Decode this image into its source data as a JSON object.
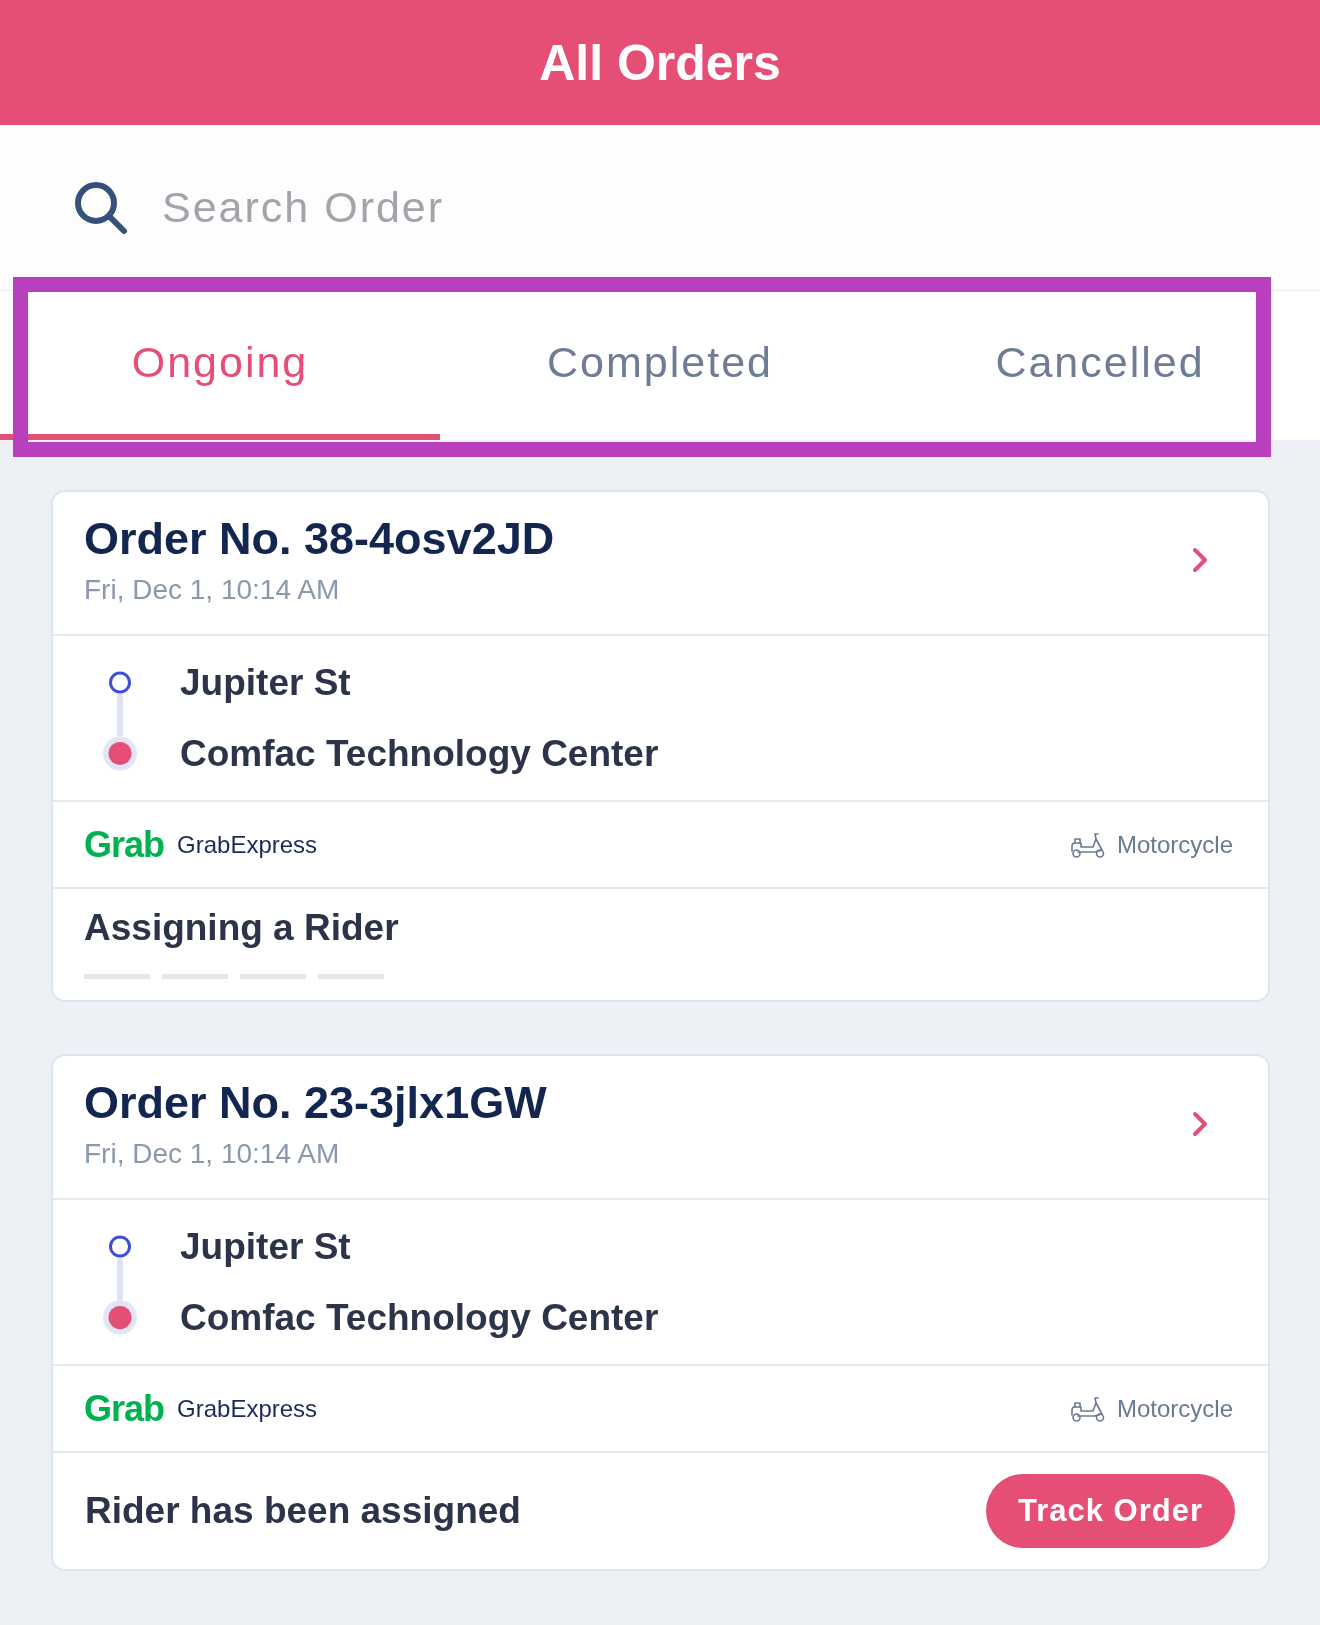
{
  "header": {
    "title": "All Orders"
  },
  "search": {
    "placeholder": "Search Order"
  },
  "tabs": {
    "highlighted": true,
    "items": [
      {
        "label": "Ongoing",
        "selected": true
      },
      {
        "label": "Completed",
        "selected": false
      },
      {
        "label": "Cancelled",
        "selected": false
      }
    ]
  },
  "orders": [
    {
      "number": "Order No. 38-4osv2JD",
      "date": "Fri, Dec 1, 10:14 AM",
      "stops": [
        {
          "kind": "pickup",
          "name": "Jupiter St"
        },
        {
          "kind": "dropoff",
          "name": "Comfac Technology Center"
        }
      ],
      "provider": {
        "logo": "Grab",
        "service": "GrabExpress"
      },
      "vehicle": "Motorcycle",
      "status": {
        "kind": "searching",
        "text": "Assigning a Rider"
      }
    },
    {
      "number": "Order No. 23-3jlx1GW",
      "date": "Fri, Dec 1, 10:14 AM",
      "stops": [
        {
          "kind": "pickup",
          "name": "Jupiter St"
        },
        {
          "kind": "dropoff",
          "name": "Comfac Technology Center"
        }
      ],
      "provider": {
        "logo": "Grab",
        "service": "GrabExpress"
      },
      "vehicle": "Motorcycle",
      "status": {
        "kind": "assigned",
        "text": "Rider has been assigned",
        "action": "Track Order"
      }
    }
  ]
}
